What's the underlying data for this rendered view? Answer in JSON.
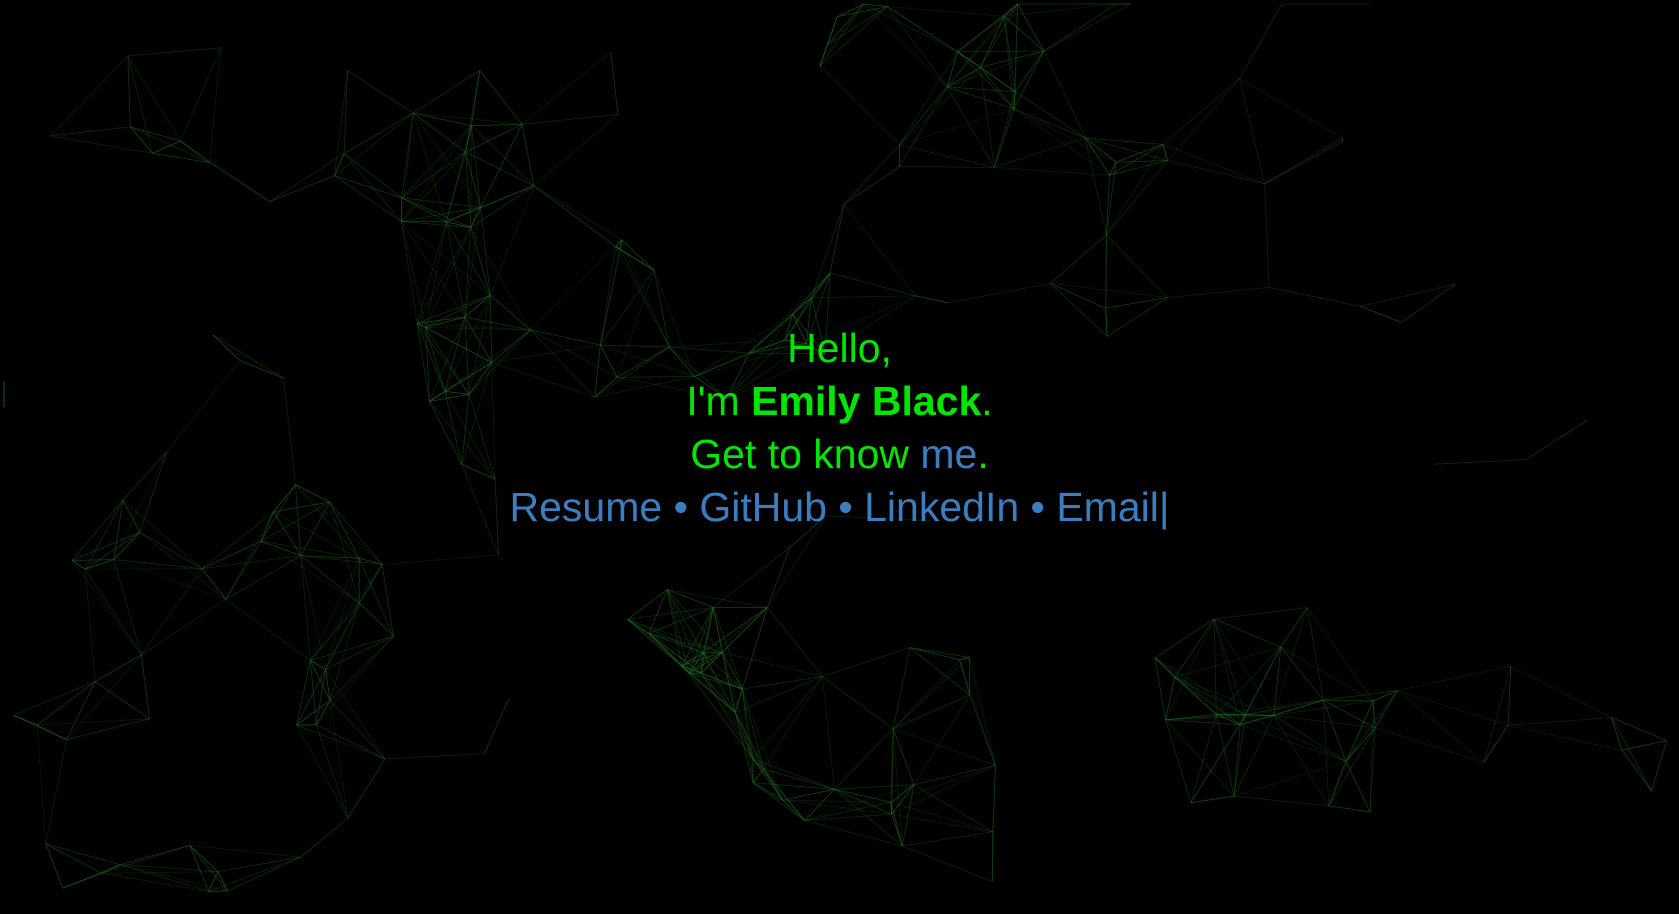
{
  "hero": {
    "greeting": "Hello,",
    "intro_prefix": "I'm ",
    "name": "Emily Black",
    "intro_suffix": ".",
    "know_prefix": "Get to know ",
    "know_link": "me",
    "know_suffix": "."
  },
  "links": [
    {
      "label": "Resume"
    },
    {
      "label": "GitHub"
    },
    {
      "label": "LinkedIn"
    },
    {
      "label": "Email"
    }
  ],
  "separator": "•",
  "caret": "|",
  "colors": {
    "background": "#000000",
    "primary_text": "#00e600",
    "link_text": "#3a7ec0",
    "network_lines": "#1f7a1f"
  }
}
